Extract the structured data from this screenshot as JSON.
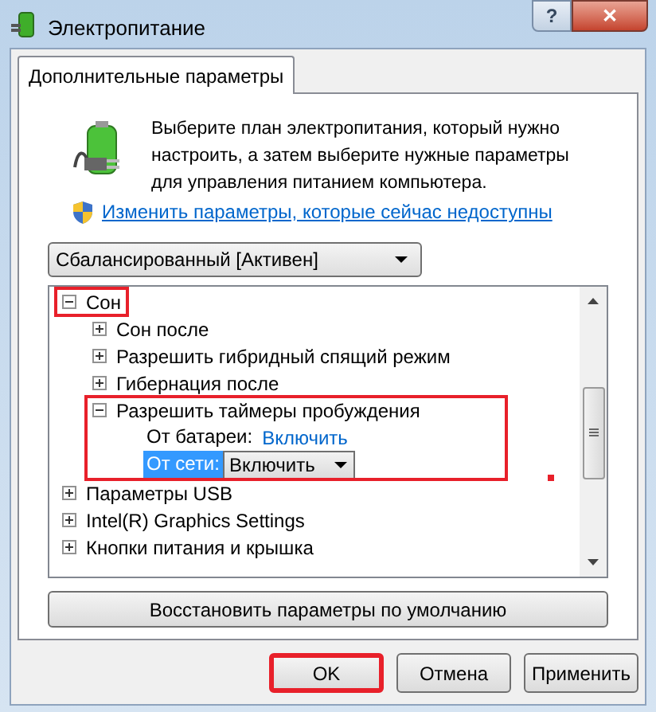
{
  "window": {
    "title": "Электропитание",
    "help_button": "?",
    "close_button": "✕"
  },
  "tabs": [
    {
      "label": "Дополнительные параметры",
      "selected": true
    }
  ],
  "intro": {
    "text": "Выберите план электропитания, который нужно настроить, а затем выберите нужные параметры для управления питанием компьютера.",
    "link": "Изменить параметры, которые сейчас недоступны"
  },
  "plan_dropdown": {
    "value": "Сбалансированный [Активен]"
  },
  "tree": [
    {
      "label": "Сон",
      "expanded": true,
      "highlighted": true,
      "children": [
        {
          "label": "Сон после",
          "expanded": false,
          "highlighted": false
        },
        {
          "label": "Разрешить гибридный спящий режим",
          "expanded": false,
          "highlighted": false
        },
        {
          "label": "Гибернация после",
          "expanded": false,
          "highlighted": false
        },
        {
          "label": "Разрешить таймеры пробуждения",
          "expanded": true,
          "highlighted": true,
          "settings": [
            {
              "kind": "link",
              "label": "От батареи:",
              "value": "Включить",
              "selected": false
            },
            {
              "kind": "dropdown",
              "label": "От сети:",
              "value": "Включить",
              "selected": true
            }
          ]
        }
      ]
    },
    {
      "label": "Параметры USB",
      "expanded": false,
      "highlighted": false
    },
    {
      "label": "Intel(R) Graphics Settings",
      "expanded": false,
      "highlighted": false
    },
    {
      "label": "Кнопки питания и крышка",
      "expanded": false,
      "highlighted": false
    }
  ],
  "restore_button": "Восстановить параметры по умолчанию",
  "buttons": [
    {
      "label": "OK",
      "highlighted": true
    },
    {
      "label": "Отмена",
      "highlighted": false
    },
    {
      "label": "Применить",
      "highlighted": false
    }
  ]
}
